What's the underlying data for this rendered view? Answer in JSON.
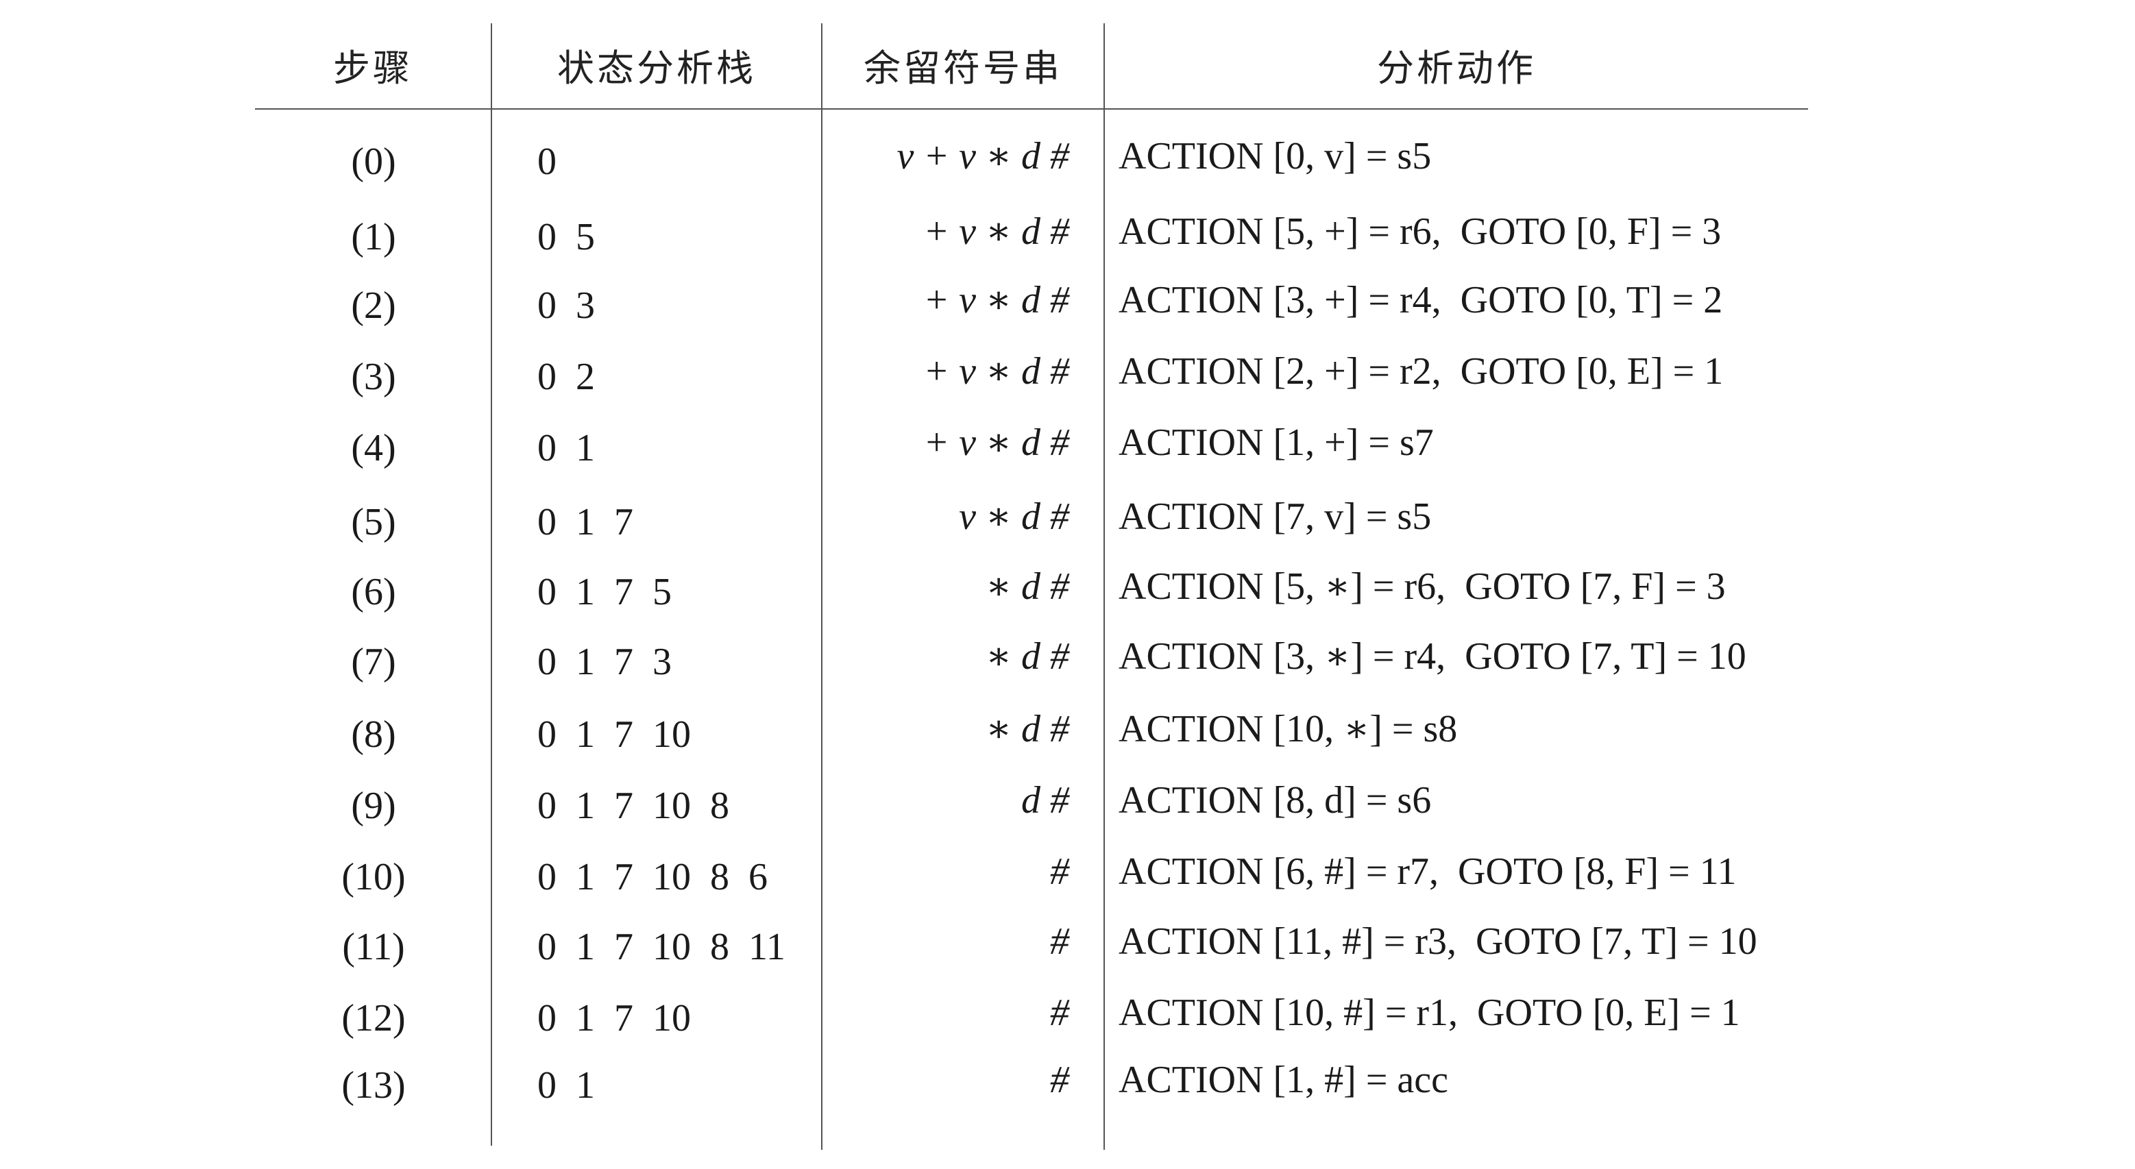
{
  "table": {
    "headers": {
      "step": "步骤",
      "stack": "状态分析栈",
      "input": "余留符号串",
      "action": "分析动作"
    },
    "rows": [
      {
        "step": "(0)",
        "stack": "0",
        "input": "v + v ∗ d #",
        "action": "ACTION [0, v] = s5"
      },
      {
        "step": "(1)",
        "stack": "0  5",
        "input": "+ v ∗ d #",
        "action": "ACTION [5, +] = r6,  GOTO [0, F] = 3"
      },
      {
        "step": "(2)",
        "stack": "0  3",
        "input": "+ v ∗ d #",
        "action": "ACTION [3, +] = r4,  GOTO [0, T] = 2"
      },
      {
        "step": "(3)",
        "stack": "0  2",
        "input": "+ v ∗ d #",
        "action": "ACTION [2, +] = r2,  GOTO [0, E] = 1"
      },
      {
        "step": "(4)",
        "stack": "0  1",
        "input": "+ v ∗ d #",
        "action": "ACTION [1, +] = s7"
      },
      {
        "step": "(5)",
        "stack": "0  1  7",
        "input": "v ∗ d #",
        "action": "ACTION [7, v] = s5"
      },
      {
        "step": "(6)",
        "stack": "0  1  7  5",
        "input": "∗ d #",
        "action": "ACTION [5, ∗] = r6,  GOTO [7, F] = 3"
      },
      {
        "step": "(7)",
        "stack": "0  1  7  3",
        "input": "∗ d #",
        "action": "ACTION [3, ∗] = r4,  GOTO [7, T] = 10"
      },
      {
        "step": "(8)",
        "stack": "0  1  7  10",
        "input": "∗ d #",
        "action": "ACTION [10, ∗] = s8"
      },
      {
        "step": "(9)",
        "stack": "0  1  7  10  8",
        "input": "d #",
        "action": "ACTION [8, d] = s6"
      },
      {
        "step": "(10)",
        "stack": "0  1  7  10  8  6",
        "input": "#",
        "action": "ACTION [6, #] = r7,  GOTO [8, F] = 11"
      },
      {
        "step": "(11)",
        "stack": "0  1  7  10  8  11",
        "input": "#",
        "action": "ACTION [11, #] = r3,  GOTO [7, T] = 10"
      },
      {
        "step": "(12)",
        "stack": "0  1  7  10",
        "input": "#",
        "action": "ACTION [10, #] = r1,  GOTO [0, E] = 1"
      },
      {
        "step": "(13)",
        "stack": "0  1",
        "input": "#",
        "action": "ACTION [1, #] = acc"
      }
    ]
  }
}
